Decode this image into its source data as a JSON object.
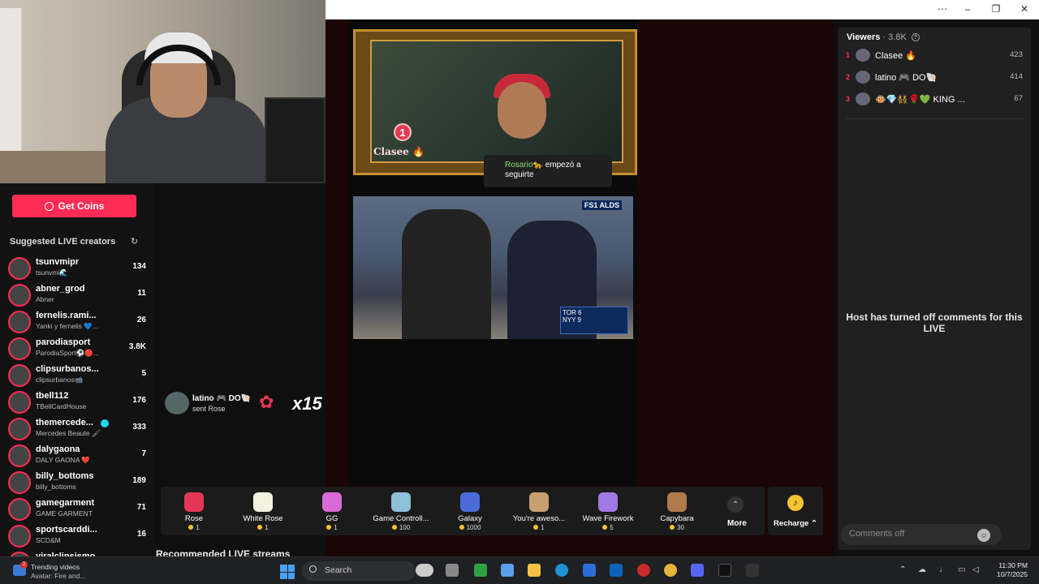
{
  "window": {
    "menu_icon": "⋯",
    "minimize_icon": "–",
    "restore_icon": "❐",
    "close_icon": "✕"
  },
  "sidebar": {
    "get_coins_label": "Get Coins",
    "suggested_title": "Suggested LIVE creators",
    "creators": [
      {
        "name": "tsunvmipr",
        "sub": "tsunvmi🌊",
        "count": "134"
      },
      {
        "name": "abner_grod",
        "sub": "Abner",
        "count": "11"
      },
      {
        "name": "fernelis.rami...",
        "sub": "Yanki y fernelis 💙...",
        "count": "26"
      },
      {
        "name": "parodiasport",
        "sub": "ParodiaSport⚽🔴...",
        "count": "3.8K"
      },
      {
        "name": "clipsurbanos...",
        "sub": "clipsurbanos📹",
        "count": "5"
      },
      {
        "name": "tbell112",
        "sub": "TBellCardHouse",
        "count": "176"
      },
      {
        "name": "themercede...",
        "sub": "Mercedes Beaute 🖌",
        "count": "333",
        "verified": true
      },
      {
        "name": "dalygaona",
        "sub": "DALY GAONA ❤️",
        "count": "7"
      },
      {
        "name": "billy_bottoms",
        "sub": "billy_bottoms",
        "count": "189"
      },
      {
        "name": "gamegarment",
        "sub": "GAME GARMENT",
        "count": "71"
      },
      {
        "name": "sportscarddi...",
        "sub": "SCD&M",
        "count": "16"
      },
      {
        "name": "viralclipsismo",
        "sub": "",
        "count": ""
      }
    ]
  },
  "stream": {
    "top_rank": "1",
    "top_name": "Clasee 🔥",
    "follow_name": "Rosario🐆",
    "follow_text": "empezó a seguirte",
    "broadcast_logo": "FS1 ALDS",
    "score_line1": "TOR 6",
    "score_line2": "NYY 9",
    "gift_sender": "latino 🎮 DO🐚",
    "gift_action": "sent Rose",
    "gift_multiplier": "x15"
  },
  "gifts": [
    {
      "name": "Rose",
      "price": "1",
      "color": "#e53656"
    },
    {
      "name": "White Rose",
      "price": "1",
      "color": "#f2f2e0"
    },
    {
      "name": "GG",
      "price": "1",
      "color": "#d86bd6"
    },
    {
      "name": "Game Controll...",
      "price": "100",
      "color": "#8ec0d8"
    },
    {
      "name": "Galaxy",
      "price": "1000",
      "color": "#4c6bd8"
    },
    {
      "name": "You're aweso...",
      "price": "1",
      "color": "#c8a070"
    },
    {
      "name": "Wave Firework",
      "price": "5",
      "color": "#a07ae0"
    },
    {
      "name": "Capybara",
      "price": "30",
      "color": "#b07a4a"
    }
  ],
  "more_label": "More",
  "recharge_label": "Recharge ⌃",
  "recommended_title": "Recommended LIVE streams",
  "viewers": {
    "title": "Viewers",
    "count": "· 3.8K",
    "list": [
      {
        "rank": "1",
        "name": "Clasee 🔥",
        "score": "423"
      },
      {
        "rank": "2",
        "name": "latino 🎮 DO🐚",
        "score": "414"
      },
      {
        "rank": "3",
        "name": "🐵💎👯🌹💚 KING ...",
        "score": "67"
      }
    ]
  },
  "comments_off_message": "Host has turned off comments for this LIVE",
  "comment_placeholder": "Comments off",
  "taskbar": {
    "news_badge": "2",
    "news_line1": "Trending videos",
    "news_line2": "Avatar: Fire and...",
    "search_label": "Search",
    "time": "11:30 PM",
    "date": "10/7/2025"
  }
}
